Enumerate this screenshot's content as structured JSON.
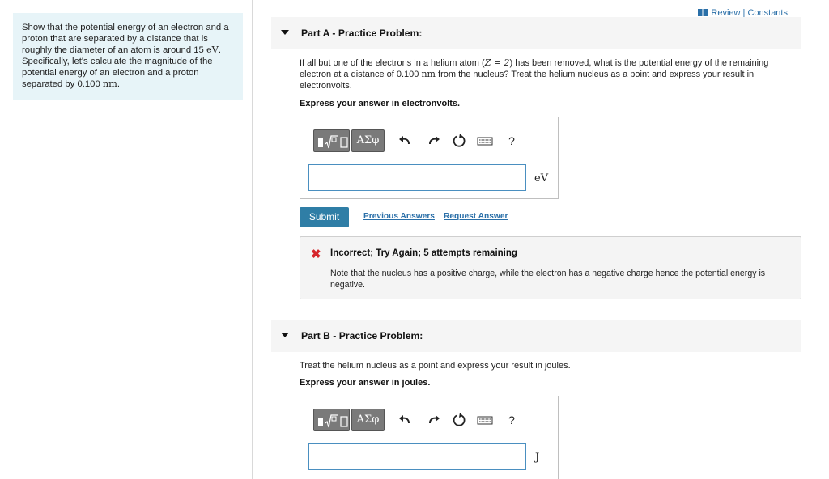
{
  "sidebar": {
    "text_before": "Show that the potential energy of an electron and a proton that are separated by a distance that is roughly the diameter of an atom is around 15 ",
    "unit_ev": "eV",
    "text_middle": ". Specifically, let's calculate the magnitude of the potential energy of an electron and a proton separated by ",
    "distance": "0.100",
    "unit_nm": "nm",
    "text_end": "."
  },
  "header": {
    "links_label": "Review | Constants"
  },
  "part_a": {
    "title": "Part A - Practice Problem:",
    "problem_before": "If all but one of the electrons in a helium atom (",
    "z_math": "Z = 2",
    "problem_middle": ") has been removed, what is the potential energy of the remaining electron at a distance of ",
    "distance": "0.100",
    "unit_nm": "nm",
    "problem_end": " from the nucleus? Treat the helium nucleus as a point and express your result in electronvolts.",
    "instruction": "Express your answer in electronvolts.",
    "unit": "eV",
    "answer_value": ""
  },
  "toolbar": {
    "greek_label": "ΑΣφ",
    "help_label": "?"
  },
  "actions": {
    "submit_label": "Submit",
    "previous_answers_label": "Previous Answers",
    "request_answer_label": "Request Answer"
  },
  "feedback": {
    "title": "Incorrect; Try Again; 5 attempts remaining",
    "text": "Note that the nucleus has a positive charge, while the electron has a negative charge hence the potential energy is negative.",
    "color": "#d6262b"
  },
  "part_b": {
    "title": "Part B - Practice Problem:",
    "problem": "Treat the helium nucleus as a point and express your result in joules.",
    "instruction": "Express your answer in joules.",
    "unit": "J",
    "answer_value": ""
  },
  "colors": {
    "accent": "#2f7ea6",
    "link": "#2a6fa8",
    "sidebar_bg": "#e7f4f8"
  }
}
